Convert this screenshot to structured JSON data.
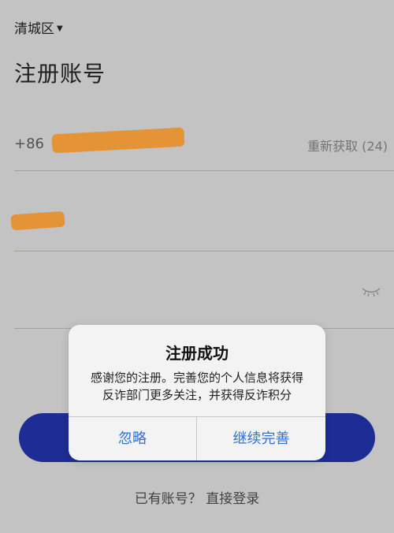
{
  "header": {
    "region": "清城区",
    "title": "注册账号"
  },
  "form": {
    "country_code": "+86",
    "resend_label": "重新获取 (24)"
  },
  "footer": {
    "login_link": "已有账号？ 直接登录"
  },
  "dialog": {
    "title": "注册成功",
    "message": "感谢您的注册。完善您的个人信息将获得反诈部门更多关注，并获得反诈积分",
    "ignore_label": "忽略",
    "continue_label": "继续完善"
  },
  "colors": {
    "primary_button": "#1f2f9c",
    "dialog_action": "#2f6fd6",
    "redaction": "#ee9a3a"
  }
}
